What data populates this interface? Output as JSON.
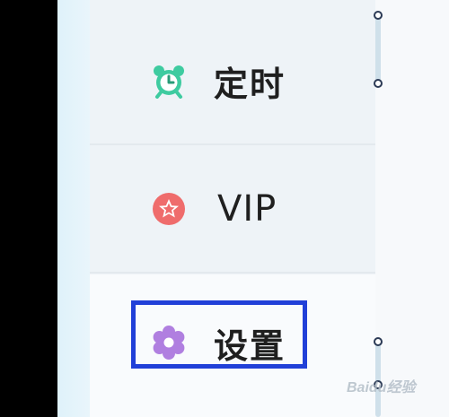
{
  "menu": {
    "items": [
      {
        "label": "定时",
        "icon": "alarm-clock-icon",
        "color": "#3ecba0"
      },
      {
        "label": "VIP",
        "icon": "star-badge-icon",
        "color": "#ef6c6c"
      },
      {
        "label": "设置",
        "icon": "flower-gear-icon",
        "color": "#b07fe0"
      }
    ],
    "highlight_color": "#2140d8"
  },
  "watermark": "Baidu经验"
}
